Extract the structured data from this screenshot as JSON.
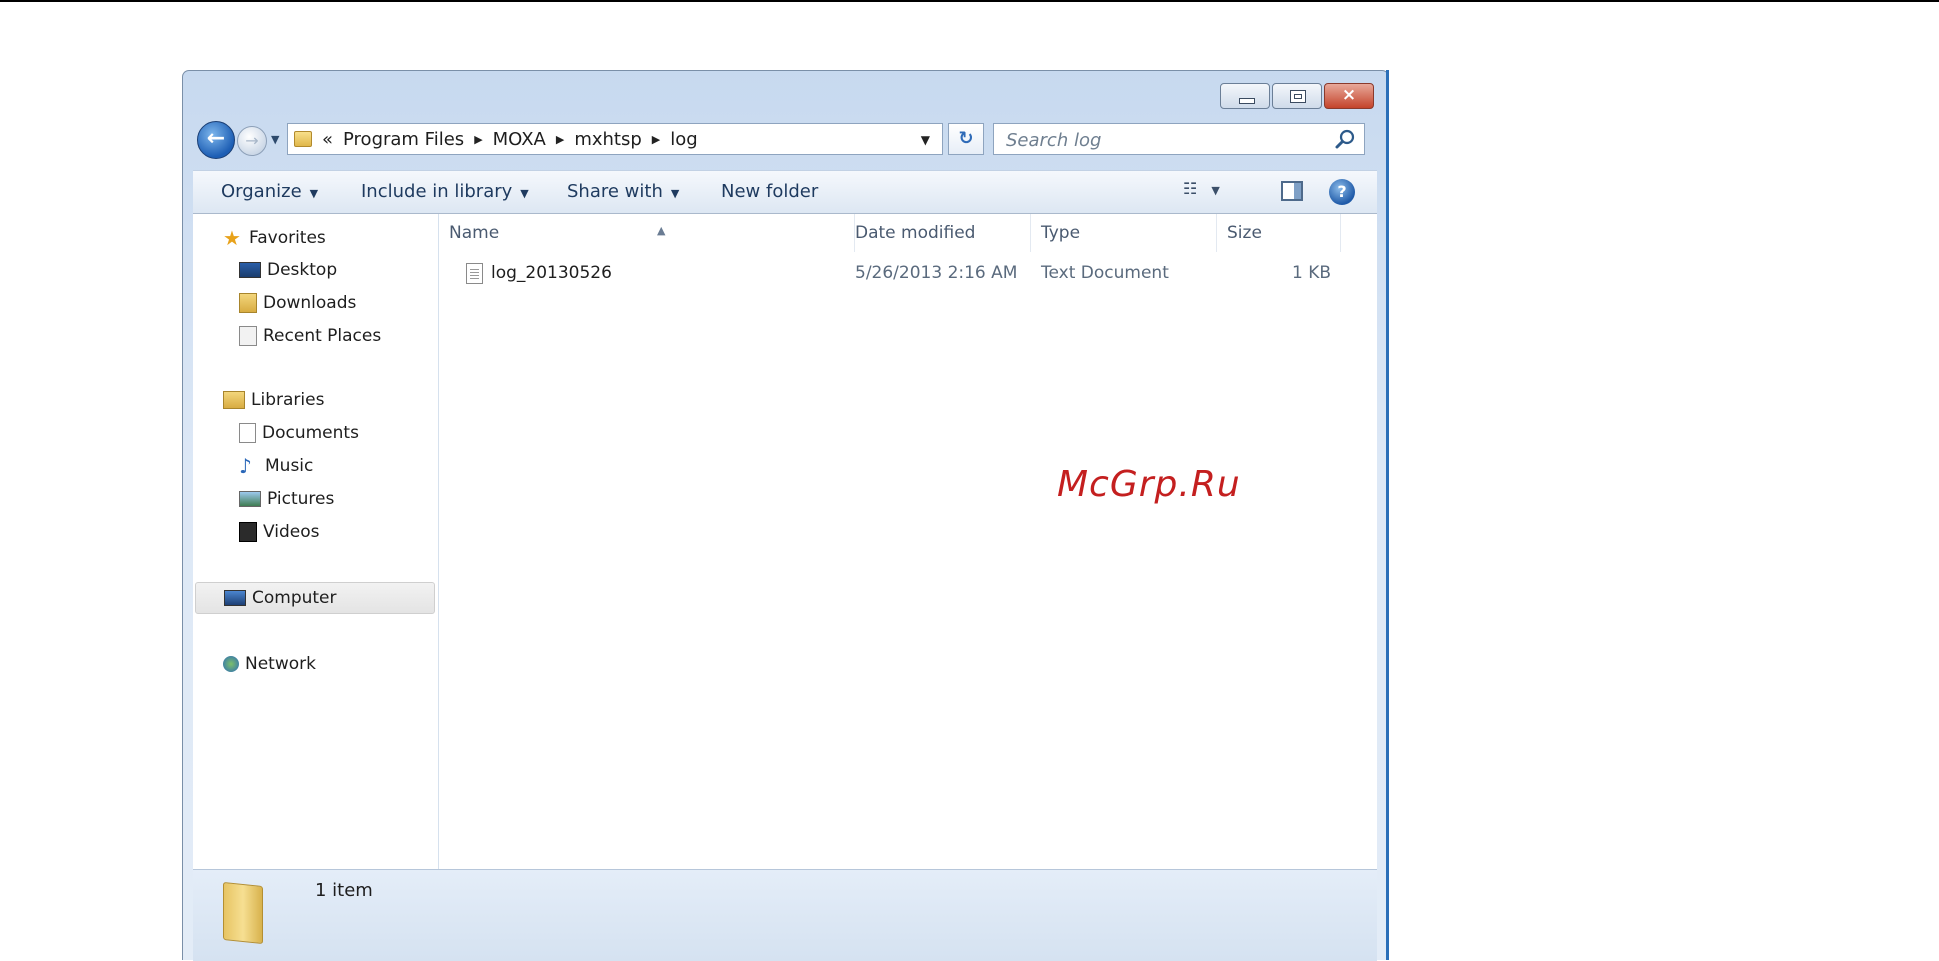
{
  "window": {
    "caption_buttons": {
      "minimize": "minimize-icon",
      "maximize": "maximize-icon",
      "close": "×"
    }
  },
  "nav": {
    "breadcrumb_overflow": "«",
    "breadcrumbs": [
      "Program Files",
      "MOXA",
      "mxhtsp",
      "log"
    ],
    "refresh_icon": "↻",
    "search_placeholder": "Search log"
  },
  "toolbar": {
    "organize": "Organize",
    "include_in_library": "Include in library",
    "share_with": "Share with",
    "new_folder": "New folder"
  },
  "sidebar": {
    "favorites": "Favorites",
    "favorites_items": [
      "Desktop",
      "Downloads",
      "Recent Places"
    ],
    "libraries": "Libraries",
    "libraries_items": [
      "Documents",
      "Music",
      "Pictures",
      "Videos"
    ],
    "computer": "Computer",
    "network": "Network"
  },
  "columns": [
    "Name",
    "Date modified",
    "Type",
    "Size"
  ],
  "files": [
    {
      "name": "log_20130526",
      "date_modified": "5/26/2013 2:16 AM",
      "type": "Text Document",
      "size": "1 KB"
    }
  ],
  "watermark": "McGrp.Ru",
  "status": {
    "item_count": "1 item"
  },
  "colors": {
    "accent": "#2b6fb8",
    "watermark": "#c41f1f"
  }
}
